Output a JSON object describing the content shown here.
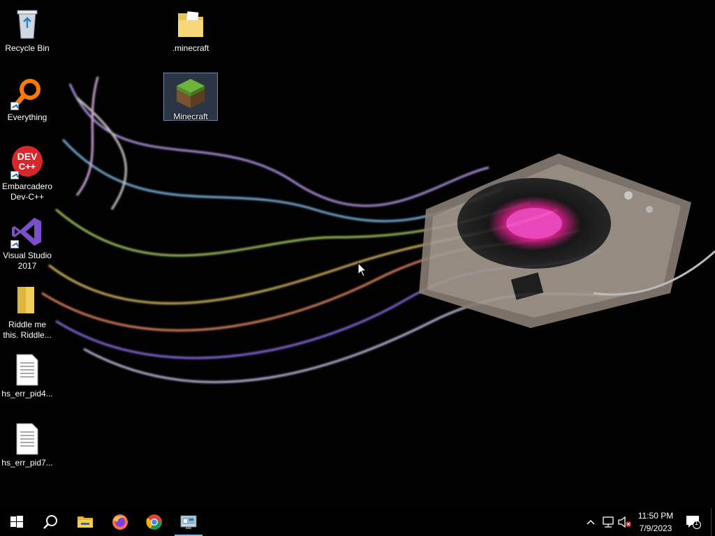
{
  "desktop": {
    "icons": [
      {
        "label": "Recycle Bin",
        "icon": "recycle-bin-icon"
      },
      {
        "label": ".minecraft",
        "icon": "folder-icon"
      },
      {
        "label": "Everything",
        "icon": "everything-search-icon"
      },
      {
        "label": "Minecraft",
        "icon": "minecraft-grass-block-icon"
      },
      {
        "label": "Embarcadero Dev-C++",
        "icon": "devcpp-icon",
        "icon_text": "DEV C++"
      },
      {
        "label": "Visual Studio 2017",
        "icon": "visual-studio-icon"
      },
      {
        "label": "Riddle me this. Riddle...",
        "icon": "folder-icon"
      },
      {
        "label": "hs_err_pid4...",
        "icon": "text-file-icon"
      },
      {
        "label": "hs_err_pid7...",
        "icon": "text-file-icon"
      }
    ]
  },
  "taskbar": {
    "buttons": [
      {
        "name": "start",
        "icon": "windows-logo-icon"
      },
      {
        "name": "search",
        "icon": "search-icon"
      },
      {
        "name": "file-explorer",
        "icon": "folder-icon"
      },
      {
        "name": "firefox",
        "icon": "firefox-icon"
      },
      {
        "name": "chrome",
        "icon": "chrome-icon"
      },
      {
        "name": "control-panel",
        "icon": "control-panel-icon",
        "active": true
      }
    ],
    "tray": {
      "icons": [
        "chevron-up-icon",
        "network-icon",
        "volume-muted-icon"
      ],
      "time": "11:50 PM",
      "date": "7/9/2023",
      "notification_count": "1"
    }
  },
  "colors": {
    "accent": "#76b9ed",
    "taskbar": "#000000",
    "selection": "#5a7aa8"
  }
}
